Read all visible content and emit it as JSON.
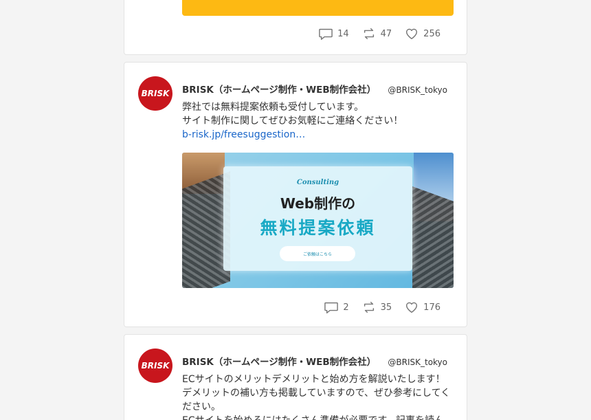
{
  "posts": [
    {
      "counts": {
        "comments": "14",
        "retweets": "47",
        "likes": "256"
      }
    },
    {
      "avatar_text": "BRISK",
      "name": "BRISK（ホームページ制作・WEB制作会社）",
      "handle": "@BRISK_tokyo",
      "lines": [
        "弊社では無料提案依頼も受付しています。",
        "サイト制作に関してぜひお気軽にご連絡ください！"
      ],
      "link": "b-risk.jp/freesuggestion…",
      "image": {
        "consulting": "Consulting",
        "web": "Web制作の",
        "muryo": "無料提案依頼",
        "button": "ご依頼はこちら"
      },
      "counts": {
        "comments": "2",
        "retweets": "35",
        "likes": "176"
      }
    },
    {
      "avatar_text": "BRISK",
      "name": "BRISK（ホームページ制作・WEB制作会社）",
      "handle": "@BRISK_tokyo",
      "lines": [
        "ECサイトのメリットデメリットと始め方を解説いたします！",
        "デメリットの補い方も掲載していますので、ぜひ参考にしてください。",
        "ECサイトを始めるにはたくさん準備が必要です。記事を読ん"
      ]
    }
  ],
  "colors": {
    "brand": "#c8161d",
    "link": "#1a66c9",
    "accent_yellow": "#fdb913"
  }
}
